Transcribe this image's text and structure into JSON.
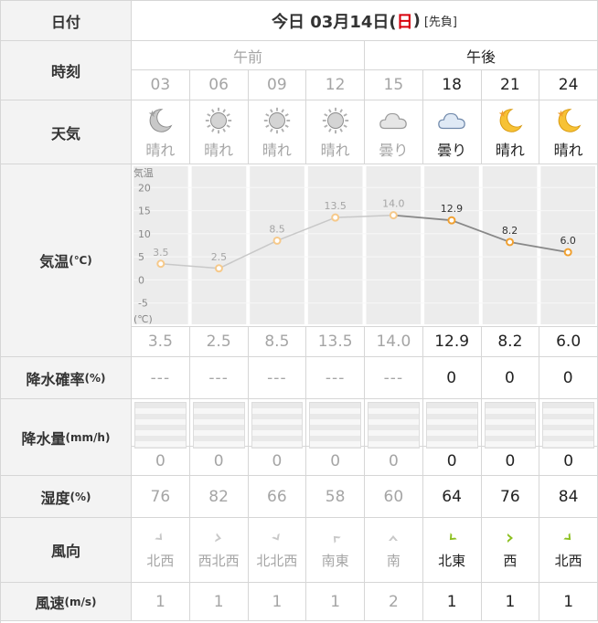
{
  "header": {
    "label_date": "日付",
    "date_prefix": "今日 03月14日(",
    "weekday": "日",
    "date_suffix": ")",
    "rokuyo": "[先負]"
  },
  "labels": {
    "time": "時刻",
    "weather": "天気",
    "temp_main": "気温",
    "temp_unit": "(℃)",
    "rain_prob_main": "降水確率",
    "rain_prob_unit": "(%)",
    "rain_amount_main": "降水量",
    "rain_amount_unit": "(mm/h)",
    "humidity_main": "湿度",
    "humidity_unit": "(%)",
    "wind_dir": "風向",
    "wind_speed_main": "風速",
    "wind_speed_unit": "(m/s)"
  },
  "ampm": {
    "am": "午前",
    "pm": "午後"
  },
  "hours": [
    "03",
    "06",
    "09",
    "12",
    "15",
    "18",
    "21",
    "24"
  ],
  "weather": [
    {
      "icon": "moon-icon",
      "text": "晴れ"
    },
    {
      "icon": "sun-icon",
      "text": "晴れ"
    },
    {
      "icon": "sun-icon",
      "text": "晴れ"
    },
    {
      "icon": "sun-icon",
      "text": "晴れ"
    },
    {
      "icon": "cloud-icon",
      "text": "曇り"
    },
    {
      "icon": "cloud-icon",
      "text": "曇り"
    },
    {
      "icon": "moon-icon",
      "text": "晴れ"
    },
    {
      "icon": "moon-icon",
      "text": "晴れ"
    }
  ],
  "temperature": [
    "3.5",
    "2.5",
    "8.5",
    "13.5",
    "14.0",
    "12.9",
    "8.2",
    "6.0"
  ],
  "rain_prob": [
    "---",
    "---",
    "---",
    "---",
    "---",
    "0",
    "0",
    "0"
  ],
  "rain_amount": [
    "0",
    "0",
    "0",
    "0",
    "0",
    "0",
    "0",
    "0"
  ],
  "humidity": [
    "76",
    "82",
    "66",
    "58",
    "60",
    "64",
    "76",
    "84"
  ],
  "wind_dir": [
    "北西",
    "西北西",
    "北北西",
    "南東",
    "南",
    "北東",
    "西",
    "北西"
  ],
  "wind_speed": [
    "1",
    "1",
    "1",
    "1",
    "2",
    "1",
    "1",
    "1"
  ],
  "past_count": 5,
  "colors": {
    "past_text": "#a5a5a5",
    "current_text": "#222222",
    "accent_orange": "#f0a030",
    "wind_green": "#8cc020",
    "header_bg": "#f3f3f3",
    "sunday_red": "#d8000c"
  },
  "chart_data": {
    "type": "line",
    "x": [
      "03",
      "06",
      "09",
      "12",
      "15",
      "18",
      "21",
      "24"
    ],
    "values": [
      3.5,
      2.5,
      8.5,
      13.5,
      14.0,
      12.9,
      8.2,
      6.0
    ],
    "ylabel": "気温",
    "unit_label": "(℃)",
    "yticks": [
      20,
      15,
      10,
      5,
      0,
      -5
    ],
    "ylim": [
      -10,
      25
    ],
    "grid": true
  }
}
